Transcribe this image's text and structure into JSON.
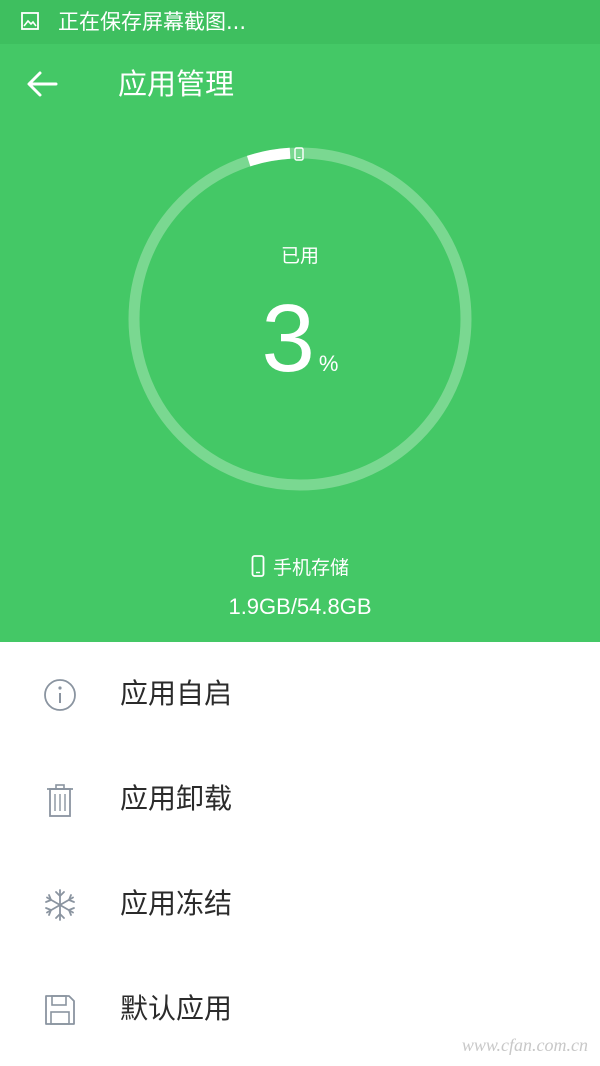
{
  "status_bar": {
    "text": "正在保存屏幕截图...",
    "icon": "image-icon"
  },
  "header": {
    "title": "应用管理",
    "back_icon": "arrow-left-icon"
  },
  "usage": {
    "label": "已用",
    "percent": "3",
    "unit": "%",
    "fraction": 0.03
  },
  "storage": {
    "label": "手机存储",
    "amount": "1.9GB/54.8GB",
    "icon": "phone-icon"
  },
  "menu": {
    "items": [
      {
        "label": "应用自启",
        "icon": "info-icon"
      },
      {
        "label": "应用卸载",
        "icon": "trash-icon"
      },
      {
        "label": "应用冻结",
        "icon": "snowflake-icon"
      },
      {
        "label": "默认应用",
        "icon": "save-icon"
      }
    ]
  },
  "watermark": "www.cfan.com.cn",
  "colors": {
    "header_bg": "#44c866",
    "status_bg": "#3ebf5f",
    "ring_track": "#7ad891",
    "icon_gray": "#8a94a0",
    "text_dark": "#2b2b2b"
  }
}
